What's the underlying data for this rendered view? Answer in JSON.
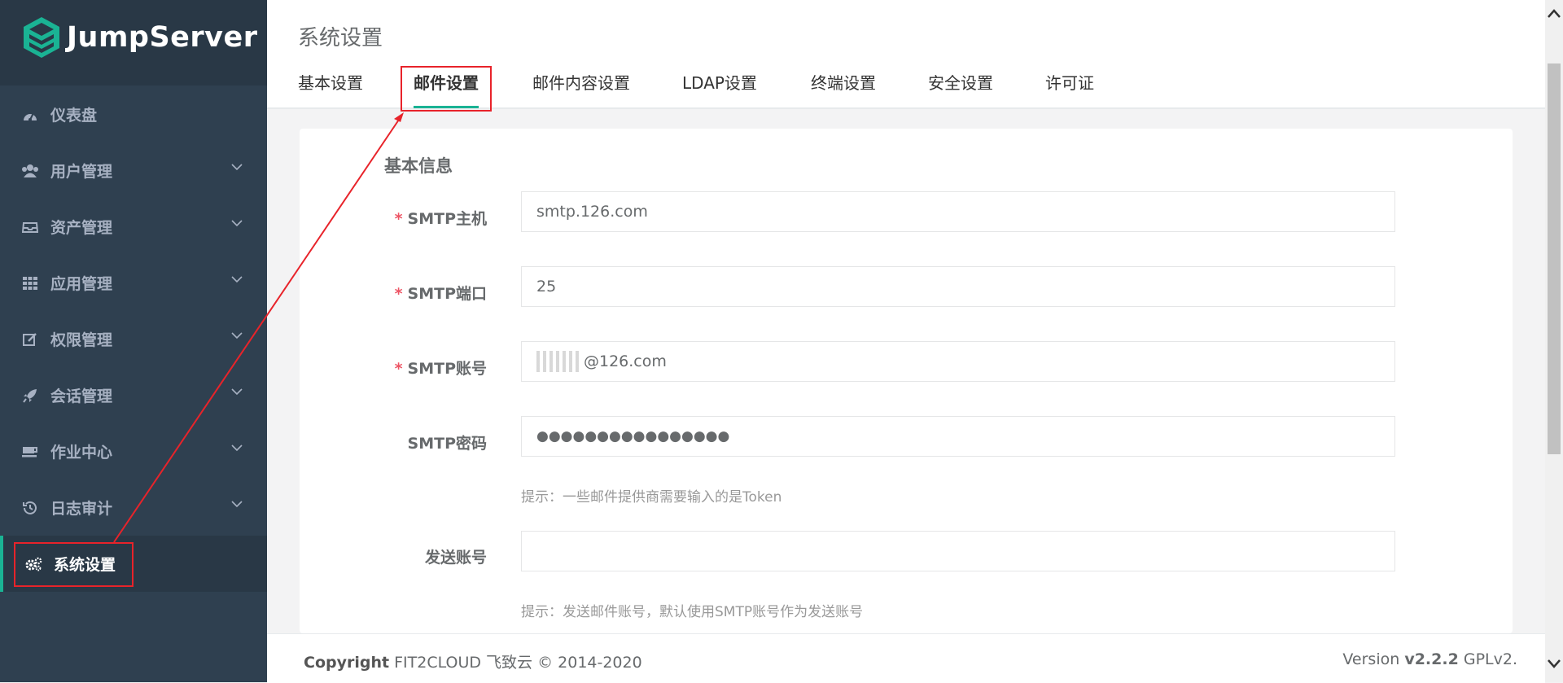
{
  "brand": {
    "name": "JumpServer"
  },
  "sidebar": {
    "items": [
      {
        "label": "仪表盘",
        "icon": "dashboard-icon",
        "has_submenu": false
      },
      {
        "label": "用户管理",
        "icon": "users-icon",
        "has_submenu": true
      },
      {
        "label": "资产管理",
        "icon": "inbox-icon",
        "has_submenu": true
      },
      {
        "label": "应用管理",
        "icon": "grid-icon",
        "has_submenu": true
      },
      {
        "label": "权限管理",
        "icon": "edit-icon",
        "has_submenu": true
      },
      {
        "label": "会话管理",
        "icon": "rocket-icon",
        "has_submenu": true
      },
      {
        "label": "作业中心",
        "icon": "coffee-icon",
        "has_submenu": true
      },
      {
        "label": "日志审计",
        "icon": "history-icon",
        "has_submenu": true
      },
      {
        "label": "系统设置",
        "icon": "gears-icon",
        "has_submenu": false,
        "active": true
      }
    ]
  },
  "page": {
    "title": "系统设置"
  },
  "tabs": [
    {
      "label": "基本设置"
    },
    {
      "label": "邮件设置",
      "active": true
    },
    {
      "label": "邮件内容设置"
    },
    {
      "label": "LDAP设置"
    },
    {
      "label": "终端设置"
    },
    {
      "label": "安全设置"
    },
    {
      "label": "许可证"
    }
  ],
  "form": {
    "section_title": "基本信息",
    "smtp_host": {
      "label": "SMTP主机",
      "required": true,
      "value": "smtp.126.com"
    },
    "smtp_port": {
      "label": "SMTP端口",
      "required": true,
      "value": "25"
    },
    "smtp_account": {
      "label": "SMTP账号",
      "required": true,
      "value_visible": "@126.com"
    },
    "smtp_password": {
      "label": "SMTP密码",
      "required": false,
      "value": "●●●●●●●●●●●●●●●●",
      "hint": "提示：一些邮件提供商需要输入的是Token"
    },
    "sender_account": {
      "label": "发送账号",
      "required": false,
      "value": "",
      "hint": "提示：发送邮件账号，默认使用SMTP账号作为发送账号"
    },
    "required_mark": "*"
  },
  "footer": {
    "copyright_label": "Copyright",
    "copyright_text": "FIT2CLOUD 飞致云 © 2014-2020",
    "version_label": "Version",
    "version_number": "v2.2.2",
    "license": "GPLv2."
  },
  "colors": {
    "sidebar_bg": "#2f4050",
    "accent": "#1ab394",
    "annotation_red": "#e8232a",
    "required_red": "#ed5565"
  }
}
